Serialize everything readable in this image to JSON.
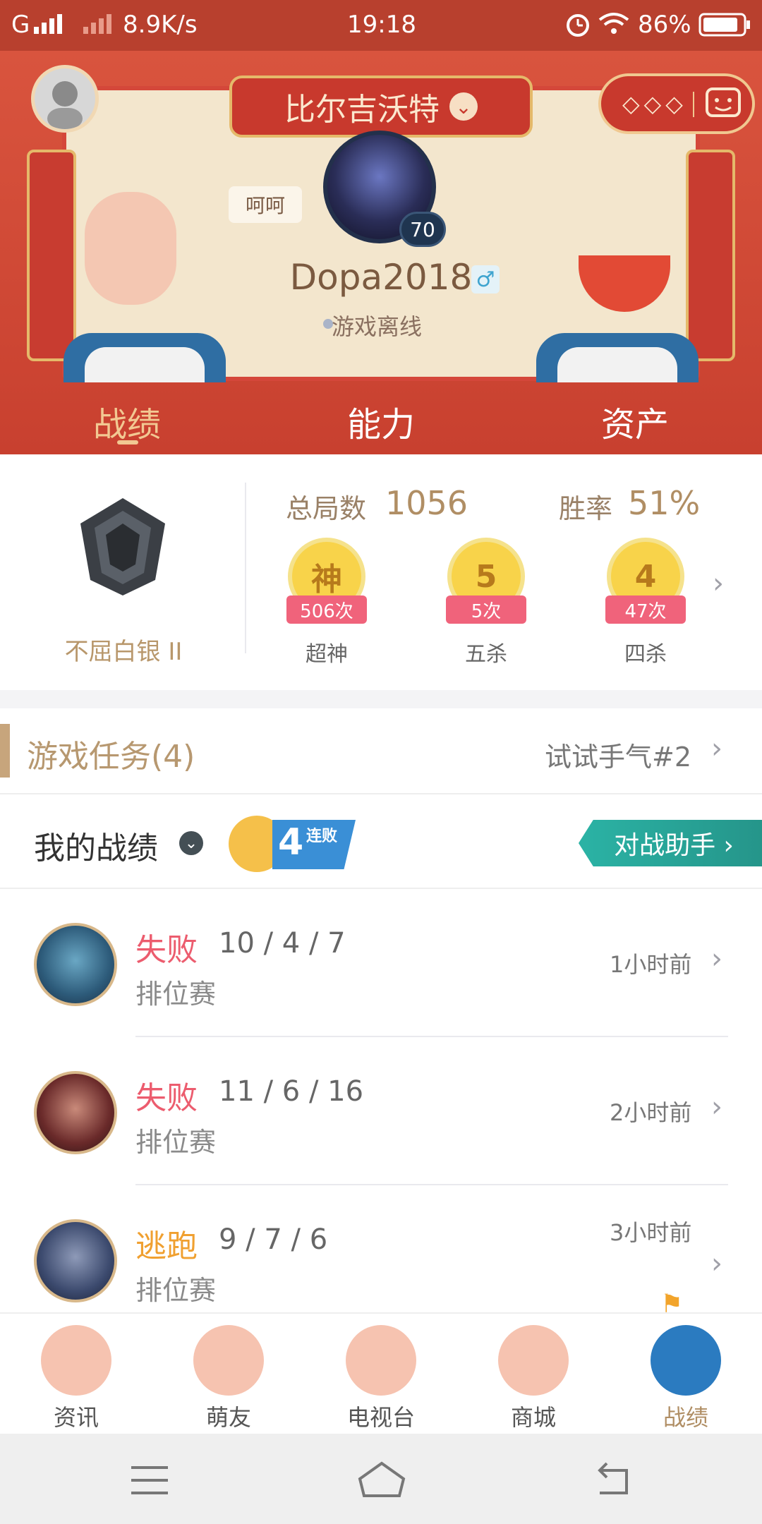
{
  "status_bar": {
    "carrier": "G",
    "speed": "8.9K/s",
    "time": "19:18",
    "battery": "86%"
  },
  "header": {
    "server": "比尔吉沃特",
    "nickname_tag": "呵呵",
    "level": "70",
    "username": "Dopa2018",
    "gender_symbol": "♂",
    "status": "游戏离线",
    "more_dots": "◇◇◇"
  },
  "tabs": [
    {
      "label": "战绩"
    },
    {
      "label": "能力"
    },
    {
      "label": "资产"
    }
  ],
  "rank": {
    "name": "不屈白银 II"
  },
  "summary": {
    "total_label": "总局数",
    "total_value": "1056",
    "winrate_label": "胜率",
    "winrate_value": "51%"
  },
  "achievements": [
    {
      "glyph": "神",
      "count": "506次",
      "label": "超神"
    },
    {
      "glyph": "5",
      "count": "5次",
      "label": "五杀"
    },
    {
      "glyph": "4",
      "count": "47次",
      "label": "四杀"
    }
  ],
  "tasks": {
    "title": "游戏任务(4)",
    "right_text": "试试手气#2"
  },
  "my_stats": {
    "title": "我的战绩",
    "streak_number": "4",
    "streak_text": "连败",
    "assistant_button": "对战助手 ›"
  },
  "matches": [
    {
      "result": "失败",
      "kda": "10 / 4 / 7",
      "mode": "排位赛",
      "time": "1小时前",
      "result_color": "#ec5c6e"
    },
    {
      "result": "失败",
      "kda": "11 / 6 / 16",
      "mode": "排位赛",
      "time": "2小时前",
      "result_color": "#ec5c6e"
    },
    {
      "result": "逃跑",
      "kda": "9 / 7 / 6",
      "mode": "排位赛",
      "time": "3小时前",
      "result_color": "#f0a030"
    }
  ],
  "bottom_nav": [
    {
      "label": "资讯"
    },
    {
      "label": "萌友"
    },
    {
      "label": "电视台"
    },
    {
      "label": "商城"
    },
    {
      "label": "战绩"
    }
  ],
  "colors": {
    "header_red": "#c8402f",
    "accent_gold": "#b08e64",
    "teal": "#2bb3a5"
  }
}
